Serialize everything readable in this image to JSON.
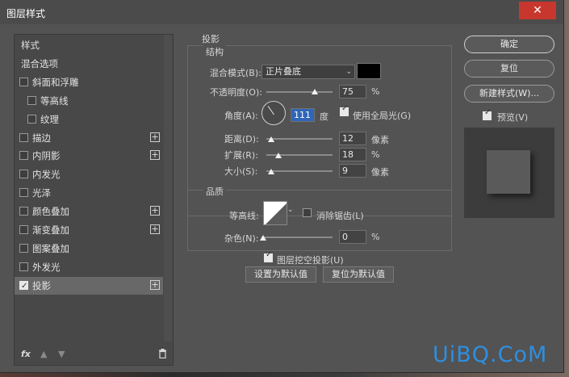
{
  "window": {
    "title": "图层样式",
    "close_glyph": "✕"
  },
  "left_list": {
    "items": [
      {
        "label": "样式",
        "checkbox": false
      },
      {
        "label": "混合选项",
        "checkbox": false
      },
      {
        "label": "斜面和浮雕",
        "checkbox": true,
        "checked": false
      },
      {
        "label": "等高线",
        "checkbox": true,
        "checked": false,
        "indent": true
      },
      {
        "label": "纹理",
        "checkbox": true,
        "checked": false,
        "indent": true
      },
      {
        "label": "描边",
        "checkbox": true,
        "checked": false,
        "plus": true
      },
      {
        "label": "内阴影",
        "checkbox": true,
        "checked": false,
        "plus": true
      },
      {
        "label": "内发光",
        "checkbox": true,
        "checked": false
      },
      {
        "label": "光泽",
        "checkbox": true,
        "checked": false
      },
      {
        "label": "颜色叠加",
        "checkbox": true,
        "checked": false,
        "plus": true
      },
      {
        "label": "渐变叠加",
        "checkbox": true,
        "checked": false,
        "plus": true
      },
      {
        "label": "图案叠加",
        "checkbox": true,
        "checked": false
      },
      {
        "label": "外发光",
        "checkbox": true,
        "checked": false
      },
      {
        "label": "投影",
        "checkbox": true,
        "checked": true,
        "plus": true,
        "selected": true
      }
    ],
    "footer": {
      "fx": "fx",
      "up_icon": "arrow-up-icon",
      "down_icon": "arrow-down-icon",
      "trash_icon": "trash-icon"
    }
  },
  "drop_shadow": {
    "heading": "投影",
    "structure": {
      "legend": "结构",
      "blend_mode_label": "混合模式(B):",
      "blend_mode_value": "正片叠底",
      "shadow_color": "#000000",
      "opacity_label": "不透明度(O):",
      "opacity_value": "75",
      "opacity_unit": "%",
      "angle_label": "角度(A):",
      "angle_value": "111",
      "angle_unit": "度",
      "global_light_label": "使用全局光(G)",
      "global_light_checked": true,
      "distance_label": "距离(D):",
      "distance_value": "12",
      "distance_unit": "像素",
      "spread_label": "扩展(R):",
      "spread_value": "18",
      "spread_unit": "%",
      "size_label": "大小(S):",
      "size_value": "9",
      "size_unit": "像素"
    },
    "quality": {
      "legend": "品质",
      "contour_label": "等高线:",
      "antialias_label": "消除锯齿(L)",
      "antialias_checked": false,
      "noise_label": "杂色(N):",
      "noise_value": "0",
      "noise_unit": "%"
    },
    "knockout_label": "图层挖空投影(U)",
    "knockout_checked": true,
    "make_default_label": "设置为默认值",
    "reset_default_label": "复位为默认值"
  },
  "right": {
    "ok_label": "确定",
    "reset_label": "复位",
    "new_style_label": "新建样式(W)...",
    "preview_label": "预览(V)",
    "preview_checked": true
  },
  "watermark": "UiBQ.CoM",
  "colors": {
    "dialog_bg": "#535353",
    "close_button": "#c8372d",
    "highlight": "#2f66b8",
    "watermark": "#2e8fe0"
  }
}
